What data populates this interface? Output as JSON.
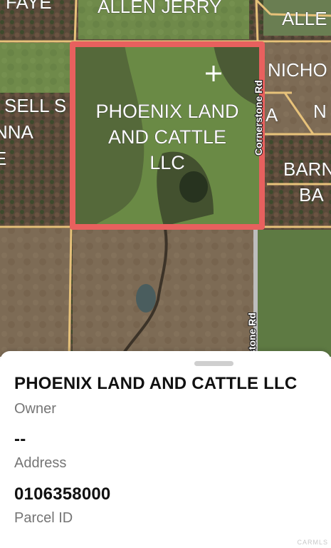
{
  "map": {
    "selected_parcel_label": [
      "PHOENIX LAND",
      "AND CATTLE",
      "LLC"
    ],
    "parcel_labels": [
      {
        "name": "label-faye",
        "text": "FAYE"
      },
      {
        "name": "label-allen-jerry",
        "text": "ALLEN JERRY"
      },
      {
        "name": "label-alle",
        "text": "ALLE"
      },
      {
        "name": "label-nicho",
        "text": "NICHO"
      },
      {
        "name": "label-a",
        "text": "A"
      },
      {
        "name": "label-n",
        "text": "N"
      },
      {
        "name": "label-sell-s",
        "text": "SELL S"
      },
      {
        "name": "label-nna",
        "text": "NNA"
      },
      {
        "name": "label-e",
        "text": "E"
      },
      {
        "name": "label-barn",
        "text": "BARN"
      },
      {
        "name": "label-ba",
        "text": "BA"
      }
    ],
    "road_labels": [
      "Cornerstone Rd",
      "stone Rd"
    ],
    "marker_icon": "crosshair-plus-icon",
    "selection_color": "#e8605e"
  },
  "sheet": {
    "owner_value": "PHOENIX LAND AND CATTLE LLC",
    "owner_label": "Owner",
    "address_value": "--",
    "address_label": "Address",
    "parcel_value": "0106358000",
    "parcel_label": "Parcel ID"
  },
  "watermark": "CARMLS"
}
